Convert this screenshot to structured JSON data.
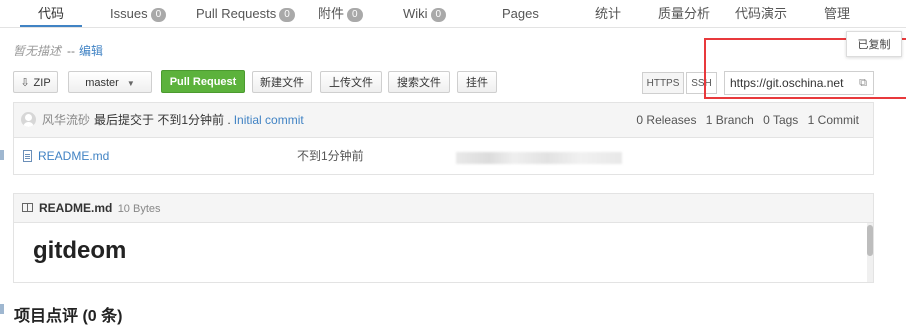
{
  "nav": {
    "tabs": [
      {
        "label": "代码",
        "badge": null
      },
      {
        "label": "Issues",
        "badge": "0"
      },
      {
        "label": "Pull Requests",
        "badge": "0"
      },
      {
        "label": "附件",
        "badge": "0"
      },
      {
        "label": "Wiki",
        "badge": "0"
      },
      {
        "label": "Pages",
        "badge": null
      },
      {
        "label": "统计",
        "badge": null
      },
      {
        "label": "质量分析",
        "badge": null
      },
      {
        "label": "代码演示",
        "badge": null
      },
      {
        "label": "管理",
        "badge": null
      }
    ],
    "active_tab": "代码"
  },
  "description": {
    "text": "暂无描述",
    "separator": "--",
    "edit_link": "编辑"
  },
  "toolbar": {
    "zip_label": "ZIP",
    "branch": "master",
    "pull_request": "Pull Request",
    "new_file": "新建文件",
    "upload_file": "上传文件",
    "search_file": "搜索文件",
    "plugin": "挂件"
  },
  "clone": {
    "https_label": "HTTPS",
    "ssh_label": "SSH",
    "url": "https://git.oschina.net",
    "copied_tooltip": "已复制"
  },
  "commit_bar": {
    "author": "风华流砂",
    "message": "最后提交于 不到1分钟前 .",
    "commit_link": "Initial commit",
    "releases": "0 Releases",
    "branches": "1 Branch",
    "tags": "0 Tags",
    "commits": "1 Commit"
  },
  "files": [
    {
      "name": "README.md",
      "time": "不到1分钟前"
    }
  ],
  "readme": {
    "filename": "README.md",
    "size": "10 Bytes",
    "heading": "gitdeom"
  },
  "section_title": "项目点评 (0 条)",
  "colors": {
    "link": "#4183c4",
    "pull_request_bg": "#5cb23c",
    "highlight_box": "#e8393c",
    "badge": "#a9a9a9"
  }
}
